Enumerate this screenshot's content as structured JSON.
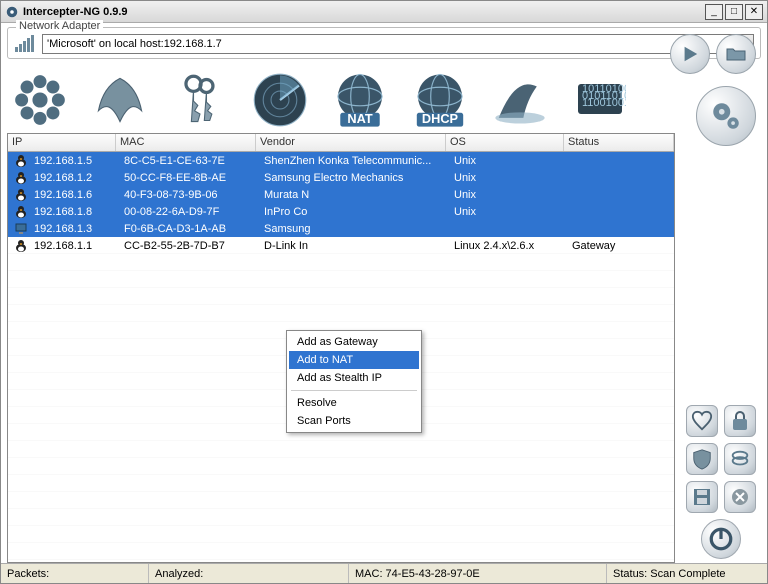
{
  "title": "Intercepter-NG 0.9.9",
  "adapter": {
    "legend": "Network Adapter",
    "selected": "'Microsoft' on local host:192.168.1.7"
  },
  "toolbar_badges": {
    "nat": "NAT",
    "dhcp": "DHCP"
  },
  "columns": {
    "ip": "IP",
    "mac": "MAC",
    "vendor": "Vendor",
    "os": "OS",
    "status": "Status"
  },
  "rows": [
    {
      "ip": "192.168.1.5",
      "mac": "8C-C5-E1-CE-63-7E",
      "vendor": "ShenZhen Konka Telecommunic...",
      "os": "Unix",
      "status": "",
      "selected": true,
      "icon": "tux"
    },
    {
      "ip": "192.168.1.2",
      "mac": "50-CC-F8-EE-8B-AE",
      "vendor": "Samsung Electro Mechanics",
      "os": "Unix",
      "status": "",
      "selected": true,
      "icon": "tux"
    },
    {
      "ip": "192.168.1.6",
      "mac": "40-F3-08-73-9B-06",
      "vendor": "Murata N",
      "os": "Unix",
      "status": "",
      "selected": true,
      "icon": "tux"
    },
    {
      "ip": "192.168.1.8",
      "mac": "00-08-22-6A-D9-7F",
      "vendor": "InPro Co",
      "os": "Unix",
      "status": "",
      "selected": true,
      "icon": "tux"
    },
    {
      "ip": "192.168.1.3",
      "mac": "F0-6B-CA-D3-1A-AB",
      "vendor": "Samsung",
      "os": "",
      "status": "",
      "selected": true,
      "icon": "monitor"
    },
    {
      "ip": "192.168.1.1",
      "mac": "CC-B2-55-2B-7D-B7",
      "vendor": "D-Link In",
      "os": "Linux 2.4.x\\2.6.x",
      "status": "Gateway",
      "selected": false,
      "icon": "tux"
    }
  ],
  "context_menu": {
    "items": [
      "Add as Gateway",
      "Add to NAT",
      "Add as Stealth IP"
    ],
    "items2": [
      "Resolve",
      "Scan Ports"
    ],
    "selected": "Add to NAT"
  },
  "statusbar": {
    "packets_label": "Packets:",
    "packets_val": "",
    "analyzed_label": "Analyzed:",
    "analyzed_val": "",
    "mac_label": "MAC: 74-E5-43-28-97-0E",
    "status_label": "Status: Scan Complete"
  }
}
